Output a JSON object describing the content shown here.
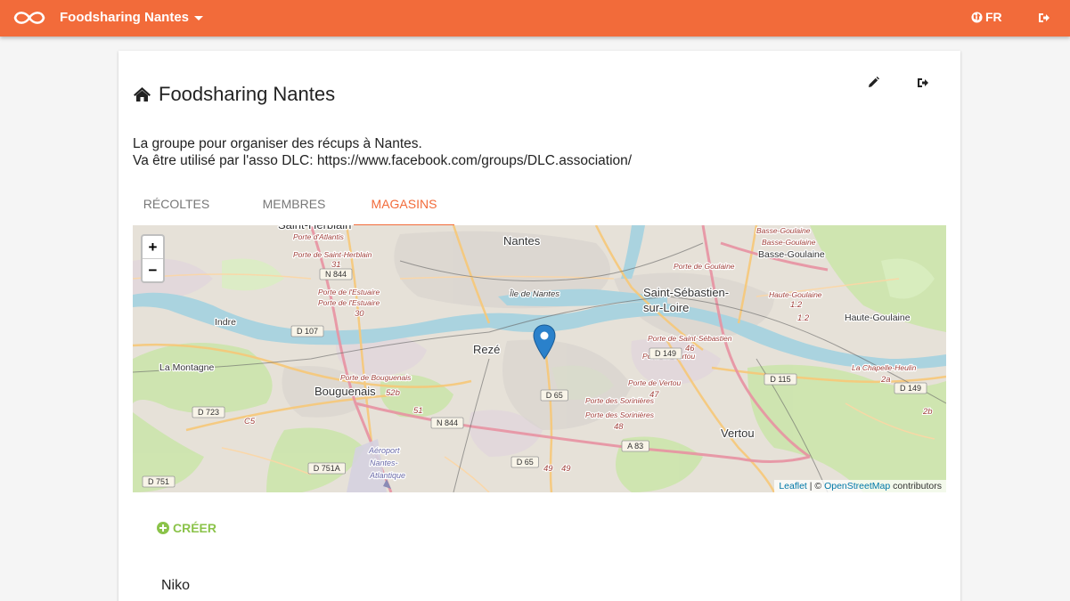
{
  "navbar": {
    "group_name": "Foodsharing Nantes",
    "language": "FR",
    "logo_icon": "infinity-logo-icon",
    "logout_icon": "sign-out-icon"
  },
  "group": {
    "title": "Foodsharing Nantes",
    "title_icon": "home-icon",
    "description_line1": "La groupe pour organiser des récups à Nantes.",
    "description_line2": "Va être utilisé par l'asso DLC: https://www.facebook.com/groups/DLC.association/",
    "edit_icon": "pencil-icon",
    "leave_icon": "sign-out-icon"
  },
  "tabs": [
    {
      "label": "RÉCOLTES",
      "active": false
    },
    {
      "label": "MEMBRES",
      "active": false
    },
    {
      "label": "MAGASINS",
      "active": true
    }
  ],
  "map": {
    "zoom_in": "+",
    "zoom_out": "−",
    "attribution_leaflet": "Leaflet",
    "attribution_sep": " | © ",
    "attribution_osm": "OpenStreetMap",
    "attribution_tail": " contributors",
    "labels": [
      {
        "text": "Nantes",
        "cls": "city"
      },
      {
        "text": "Île de Nantes",
        "cls": "small"
      },
      {
        "text": "Saint-Sébastien-",
        "cls": "city"
      },
      {
        "text": "sur-Loire",
        "cls": "city"
      },
      {
        "text": "Basse-Goulaine",
        "cls": "town"
      },
      {
        "text": "Haute-Goulaine",
        "cls": "town"
      },
      {
        "text": "Rezé",
        "cls": "city"
      },
      {
        "text": "Indre",
        "cls": "town"
      },
      {
        "text": "La Montagne",
        "cls": "town"
      },
      {
        "text": "Bouguenais",
        "cls": "city"
      },
      {
        "text": "Vertou",
        "cls": "city"
      },
      {
        "text": "Saint-Herblain",
        "cls": "city"
      },
      {
        "text": "Porte d'Atlantis",
        "cls": "exit"
      },
      {
        "text": "Porte de Saint-Herblain",
        "cls": "exit"
      },
      {
        "text": "Porte de l'Estuaire",
        "cls": "exit"
      },
      {
        "text": "Porte de l'Estuaire",
        "cls": "exit"
      },
      {
        "text": "Porte de Bouguenais",
        "cls": "exit"
      },
      {
        "text": "Porte de Goulaine",
        "cls": "exit"
      },
      {
        "text": "Porte de Saint-Sébastien",
        "cls": "exit"
      },
      {
        "text": "Porte de Vertou",
        "cls": "exit"
      },
      {
        "text": "Porte de Vertou",
        "cls": "exit"
      },
      {
        "text": "Porte des Sorinières",
        "cls": "exit"
      },
      {
        "text": "Porte des Sorinières",
        "cls": "exit"
      },
      {
        "text": "Haute-Goulaine",
        "cls": "exit"
      },
      {
        "text": "La Chapelle-Heulin",
        "cls": "exit"
      },
      {
        "text": "Basse-Goulaine",
        "cls": "exit"
      },
      {
        "text": "Basse-Goulaine",
        "cls": "exit"
      },
      {
        "text": "Aéroport",
        "cls": "airport"
      },
      {
        "text": "Nantes-",
        "cls": "airport"
      },
      {
        "text": "Atlantique",
        "cls": "airport"
      }
    ],
    "roads": [
      "N 844",
      "N 844",
      "D 107",
      "D 723",
      "D 751A",
      "D 751",
      "D 65",
      "D 65",
      "D 149",
      "D 115",
      "D 149",
      "A 83"
    ],
    "numbers": [
      "31",
      "30",
      "52b",
      "51",
      "46",
      "47",
      "48",
      "49",
      "49",
      "1.2",
      "1.2",
      "2a",
      "2b",
      "C5"
    ],
    "marker_icon": "map-marker-icon"
  },
  "create_label": "CRÉER",
  "create_icon": "plus-circle-icon",
  "stores": [
    {
      "name": "Niko"
    }
  ]
}
